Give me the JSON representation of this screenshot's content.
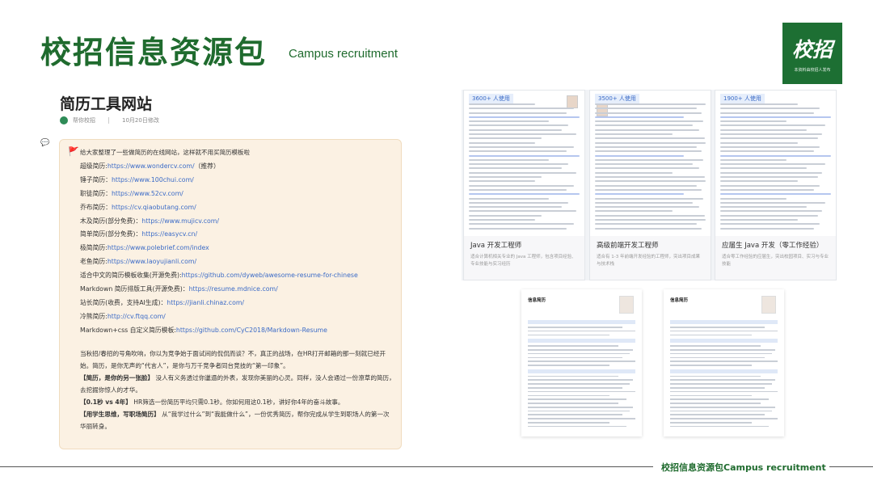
{
  "header": {
    "title": "校招信息资源包",
    "subtitle": "Campus recruitment",
    "logo_text": "校招",
    "logo_subtext": "本资料由校招人发布"
  },
  "article": {
    "title": "简历工具网站",
    "author": "帮你校招",
    "date": "10月20日修改"
  },
  "note": {
    "intro": "给大家整理了一些做简历的在线网站，这样就不用买简历模板啦",
    "links": [
      {
        "label": "超级简历:",
        "url": "https://www.wondercv.com/",
        "suffix": "（推荐）"
      },
      {
        "label": "锤子简历：",
        "url": "https://www.100chui.com/",
        "suffix": ""
      },
      {
        "label": "职徒简历：",
        "url": "https://www.52cv.com/",
        "suffix": ""
      },
      {
        "label": "乔布简历：",
        "url": "https://cv.qiaobutang.com/",
        "suffix": ""
      },
      {
        "label": "木及简历(部分免费)：",
        "url": "https://www.mujicv.com/",
        "suffix": ""
      },
      {
        "label": "简单简历(部分免费)：",
        "url": "https://easycv.cn/",
        "suffix": ""
      },
      {
        "label": "极简简历:",
        "url": "https://www.polebrief.com/index",
        "suffix": ""
      },
      {
        "label": "老鱼简历:",
        "url": "https://www.laoyujianli.com/",
        "suffix": ""
      },
      {
        "label": "适合中文的简历模板收集(开源免费):",
        "url": "https://github.com/dyweb/awesome-resume-for-chinese",
        "suffix": ""
      },
      {
        "label": "Markdown 简历排版工具(开源免费)：",
        "url": "https://resume.mdnice.com/",
        "suffix": ""
      },
      {
        "label": "站长简历(收费，支持AI生成)：",
        "url": "https://jianli.chinaz.com/",
        "suffix": ""
      },
      {
        "label": "冷熊简历:",
        "url": "http://cv.ftqq.com/",
        "suffix": ""
      },
      {
        "label": "Markdown+css 自定义简历模板:",
        "url": "https://github.com/CyC2018/Markdown-Resume",
        "suffix": ""
      }
    ],
    "para1": "当秋招/春招的号角吹响，你以为竞争始于面试间的侃侃而谈？不，真正的战场，在HR打开邮箱的那一刻就已经开始。简历，是你无声的“代言人”，是你与万千竞争者同台竞技的“第一印象”。",
    "para2_bold": "【简历，是你的另一张脸】",
    "para2": " 没人有义务透过你邋遢的外表，发现你美丽的心灵。同样，没人会通过一份潦草的简历，去挖掘你惊人的才华。",
    "para3_bold": "【0.1秒 vs 4年】",
    "para3": " HR筛选一份简历平均只需0.1秒。你如何用这0.1秒，讲好你4年的奋斗故事。",
    "para4_bold": "【用学生思维，写职场简历】",
    "para4": " 从“我学过什么”到“我能做什么”，一份优秀简历，帮你完成从学生到职场人的第一次华丽转身。"
  },
  "resume_cards": [
    {
      "badge": "3600+ 人使用",
      "title": "Java 开发工程师",
      "desc": "适合计算机相关专业的 Java 工程师，包含项目经验、专业技能与实习经历"
    },
    {
      "badge": "3500+ 人使用",
      "title": "高级前端开发工程师",
      "desc": "适合有 1-3 年前端开发经验的工程师，突出项目成果与技术栈"
    },
    {
      "badge": "1900+ 人使用",
      "title": "应届生 Java 开发（零工作经验）",
      "desc": "适合零工作经验的应届生，突出校园项目、实习与专业技能"
    }
  ],
  "resume_samples": [
    {
      "name": "信息简历"
    },
    {
      "name": "信息简历"
    }
  ],
  "footer": {
    "text": "校招信息资源包Campus recruitment"
  }
}
